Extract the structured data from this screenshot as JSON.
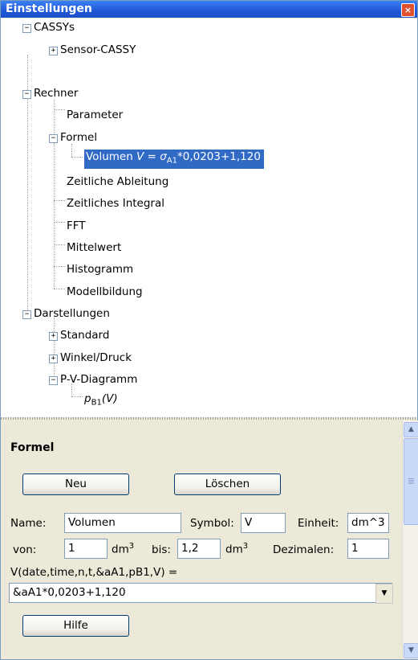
{
  "window": {
    "title": "Einstellungen",
    "close_glyph": "×"
  },
  "tree": {
    "expand_glyph": "+",
    "collapse_glyph": "−",
    "cassys": "CASSYs",
    "sensor_cassy": "Sensor-CASSY",
    "rechner": "Rechner",
    "parameter": "Parameter",
    "formel": "Formel",
    "volumen_name": "Volumen",
    "volumen_symbol": "V",
    "volumen_eq": " = ",
    "volumen_sigma": "σ",
    "volumen_sub": "A1",
    "volumen_expr": "*0,0203+1,120",
    "zeitliche_ableitung": "Zeitliche Ableitung",
    "zeitliches_integral": "Zeitliches Integral",
    "fft": "FFT",
    "mittelwert": "Mittelwert",
    "histogramm": "Histogramm",
    "modellbildung": "Modellbildung",
    "darstellungen": "Darstellungen",
    "standard": "Standard",
    "winkel_druck": "Winkel/Druck",
    "pv_diagramm": "P-V-Diagramm",
    "pb1_p": "p",
    "pb1_sub": "B1",
    "pb1_arg": "(V)"
  },
  "panel": {
    "heading": "Formel",
    "neu_label": "Neu",
    "loeschen_label": "Löschen",
    "name_label": "Name:",
    "name_value": "Volumen",
    "symbol_label": "Symbol:",
    "symbol_value": "V",
    "einheit_label": "Einheit:",
    "einheit_value": "dm^3",
    "von_label": "von:",
    "von_value": "1",
    "unit_dm": "dm",
    "unit_exp": "3",
    "bis_label": "bis:",
    "bis_value": "1,2",
    "dezimalen_label": "Dezimalen:",
    "dezimalen_value": "1",
    "formula_signature": "V(date,time,n,t,&aA1,pB1,V) =",
    "formula_value": "&aA1*0,0203+1,120",
    "dropdown_glyph": "▼",
    "hilfe_label": "Hilfe"
  },
  "scrollbar": {
    "up_glyph": "▲",
    "down_glyph": "▼"
  },
  "colors": {
    "title_bar": "#2157D7",
    "selection": "#316AC5",
    "panel_bg": "#ECE9D8",
    "close_button": "#E0502D"
  }
}
